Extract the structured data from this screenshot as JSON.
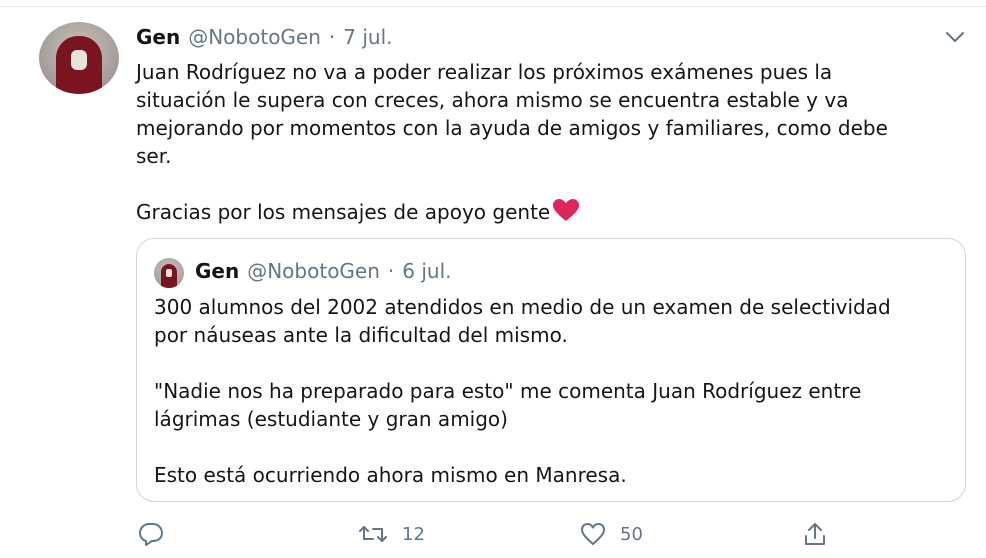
{
  "tweet": {
    "author_name": "Gen",
    "author_handle": "@NobotoGen",
    "separator": "·",
    "date": "7 jul.",
    "text_lines": [
      "Juan Rodríguez no va a poder realizar los próximos exámenes pues la",
      "situación le supera con creces, ahora mismo se encuentra estable y va",
      "mejorando por momentos con la ayuda de amigos y familiares, como debe",
      "ser."
    ],
    "closing_text": "Gracias por los mensajes de apoyo gente"
  },
  "quoted": {
    "author_name": "Gen",
    "author_handle": "@NobotoGen",
    "separator": "·",
    "date": "6 jul.",
    "paragraph1": [
      "300 alumnos del 2002 atendidos en medio de un examen de selectividad",
      "por náuseas ante la dificultad del mismo."
    ],
    "paragraph2": [
      "\"Nadie nos ha preparado para esto\" me comenta Juan Rodríguez entre",
      "lágrimas (estudiante y gran amigo)"
    ],
    "paragraph3": "Esto está ocurriendo ahora mismo en Manresa."
  },
  "actions": {
    "reply_count": "",
    "retweet_count": "12",
    "like_count": "50"
  },
  "colors": {
    "text": "#14171a",
    "secondary": "#657786",
    "border": "#ccd6dd",
    "heart": "#e0245e"
  },
  "icons": [
    "chevron-down-icon",
    "heart-emoji-icon",
    "reply-icon",
    "retweet-icon",
    "like-icon",
    "share-icon"
  ]
}
